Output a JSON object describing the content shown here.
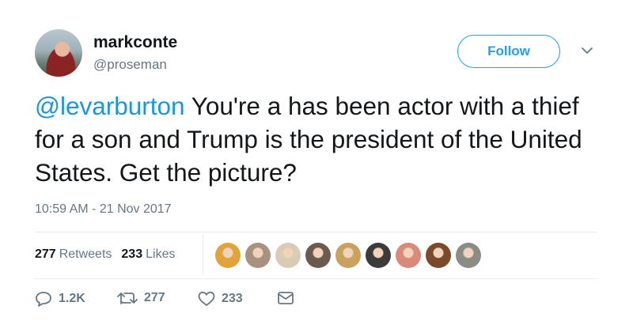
{
  "author": {
    "name": "markconte",
    "handle": "@proseman"
  },
  "follow_label": "Follow",
  "tweet": {
    "mention": "@levarburton",
    "text": " You're a has been actor with a thief for a son and Trump is the president of the United States.  Get the picture?",
    "timestamp": "10:59 AM - 21 Nov 2017"
  },
  "stats": {
    "retweets_count": "277",
    "retweets_label": "Retweets",
    "likes_count": "233",
    "likes_label": "Likes"
  },
  "liker_colors": [
    "#e0a43a",
    "#a8917f",
    "#d9cbb5",
    "#6b5a4e",
    "#c9a25d",
    "#3b3b3b",
    "#d98a7a",
    "#7a4a2a",
    "#8c8c86"
  ],
  "actions": {
    "replies": "1.2K",
    "retweets": "277",
    "likes": "233"
  },
  "colors": {
    "accent": "#1da1f2",
    "mention": "#1b95e0",
    "secondary_text": "#657786"
  }
}
